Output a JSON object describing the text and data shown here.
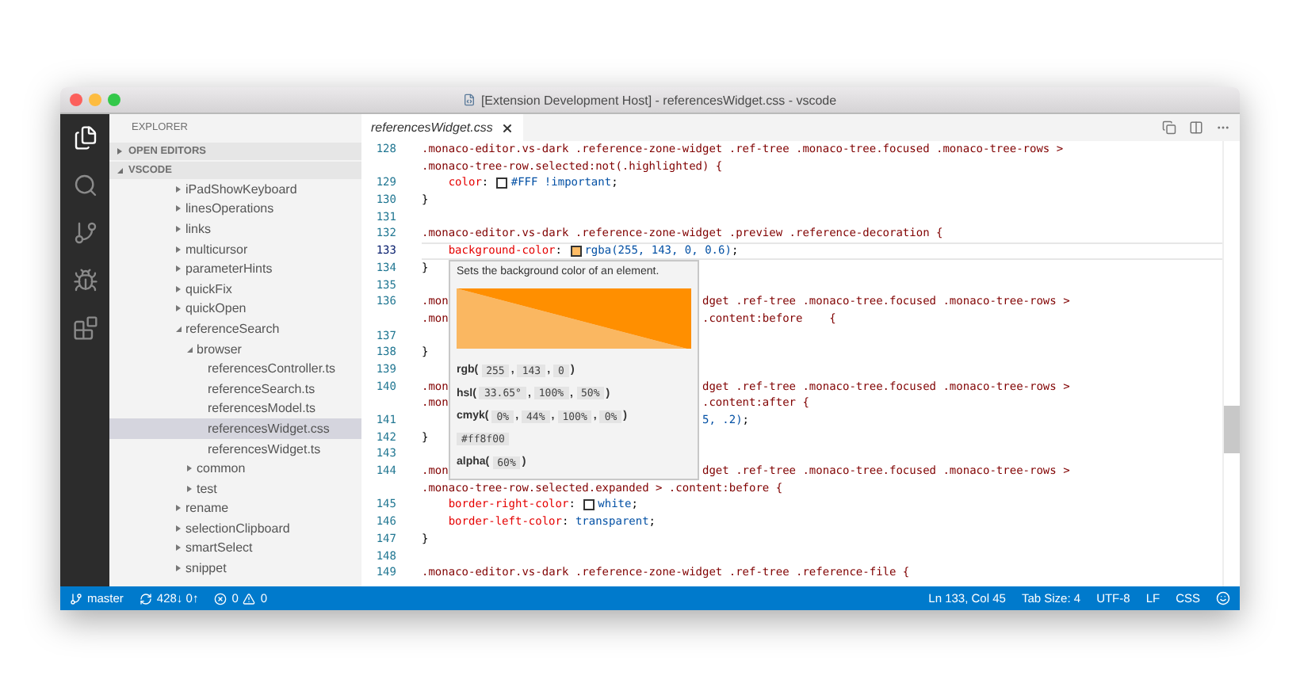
{
  "window": {
    "title": "[Extension Development Host] - referencesWidget.css - vscode"
  },
  "activity": [
    {
      "kind": "files",
      "selected": true
    },
    {
      "kind": "search",
      "selected": false
    },
    {
      "kind": "git",
      "selected": false
    },
    {
      "kind": "debug",
      "selected": false
    },
    {
      "kind": "extensions",
      "selected": false
    }
  ],
  "sidebar": {
    "title": "EXPLORER",
    "sections": [
      {
        "label": "OPEN EDITORS",
        "expanded": false
      },
      {
        "label": "VSCODE",
        "expanded": true,
        "items": [
          {
            "label": "iPadShowKeyboard",
            "expanded": false,
            "selected": false
          },
          {
            "label": "linesOperations",
            "expanded": false,
            "selected": false
          },
          {
            "label": "links",
            "expanded": false,
            "selected": false
          },
          {
            "label": "multicursor",
            "expanded": false,
            "selected": false
          },
          {
            "label": "parameterHints",
            "expanded": false,
            "selected": false
          },
          {
            "label": "quickFix",
            "expanded": false,
            "selected": false
          },
          {
            "label": "quickOpen",
            "expanded": false,
            "selected": false
          },
          {
            "label": "referenceSearch",
            "expanded": true,
            "selected": false,
            "children": [
              {
                "label": "browser",
                "expanded": true,
                "selected": false,
                "children": [
                  {
                    "label": "referencesController.ts",
                    "selected": false
                  },
                  {
                    "label": "referenceSearch.ts",
                    "selected": false
                  },
                  {
                    "label": "referencesModel.ts",
                    "selected": false
                  },
                  {
                    "label": "referencesWidget.css",
                    "selected": true
                  },
                  {
                    "label": "referencesWidget.ts",
                    "selected": false
                  }
                ]
              },
              {
                "label": "common",
                "expanded": false,
                "selected": false
              },
              {
                "label": "test",
                "expanded": false,
                "selected": false
              }
            ]
          },
          {
            "label": "rename",
            "expanded": false,
            "selected": false
          },
          {
            "label": "selectionClipboard",
            "expanded": false,
            "selected": false
          },
          {
            "label": "smartSelect",
            "expanded": false,
            "selected": false
          },
          {
            "label": "snippet",
            "expanded": false,
            "selected": false
          }
        ]
      }
    ]
  },
  "tabs": [
    {
      "label": "referencesWidget.css",
      "selected": true
    }
  ],
  "editor": {
    "lines": [
      {
        "num": "128",
        "current": false,
        "text": [
          {
            "kind": "sel",
            "text": ".monaco-editor.vs-dark .reference-zone-widget .ref-tree .monaco-tree.focused .monaco-tree-rows >"
          }
        ]
      },
      {
        "text": [
          {
            "kind": "sel",
            "text": ".monaco-tree-row.selected:not(.highlighted) {"
          }
        ]
      },
      {
        "num": "129",
        "current": false,
        "indented": true,
        "text": [
          {
            "kind": "prop",
            "text": "color"
          },
          {
            "kind": "plain",
            "text": ": "
          },
          {
            "kind": "swatch",
            "color": "#ffffff"
          },
          {
            "kind": "val",
            "text": "#FFF !important"
          },
          {
            "kind": "plain",
            "text": ";"
          }
        ]
      },
      {
        "num": "130",
        "current": false,
        "text": [
          {
            "kind": "plain",
            "text": "}"
          }
        ]
      },
      {
        "num": "131",
        "current": false
      },
      {
        "num": "132",
        "current": false,
        "text": [
          {
            "kind": "sel",
            "text": ".monaco-editor.vs-dark .reference-zone-widget .preview .reference-decoration {"
          }
        ]
      },
      {
        "num": "133",
        "current": true,
        "indented": true,
        "text": [
          {
            "kind": "prop",
            "text": "background-color"
          },
          {
            "kind": "plain",
            "text": ": "
          },
          {
            "kind": "swatch",
            "color": "#ffbc66"
          },
          {
            "kind": "val",
            "text": "rgba(255, 143, 0, 0.6)"
          },
          {
            "kind": "plain",
            "text": ";"
          }
        ]
      },
      {
        "num": "134",
        "current": false,
        "text": [
          {
            "kind": "plain",
            "text": "}"
          }
        ]
      },
      {
        "num": "135",
        "current": false
      },
      {
        "num": "136",
        "current": false,
        "text": [
          {
            "kind": "sel",
            "text": ".mon"
          }
        ],
        "tail": [
          {
            "kind": "sel",
            "text": "dget .ref-tree .monaco-tree.focused .monaco-tree-rows >"
          }
        ]
      },
      {
        "text": [
          {
            "kind": "sel",
            "text": ".mon"
          }
        ],
        "tail": [
          {
            "kind": "sel",
            "text": ".content:before    {"
          }
        ]
      },
      {
        "num": "137",
        "current": false
      },
      {
        "num": "138",
        "current": false,
        "text": [
          {
            "kind": "plain",
            "text": "}"
          }
        ]
      },
      {
        "num": "139",
        "current": false
      },
      {
        "num": "140",
        "current": false,
        "text": [
          {
            "kind": "sel",
            "text": ".mon"
          }
        ],
        "tail": [
          {
            "kind": "sel",
            "text": "dget .ref-tree .monaco-tree.focused .monaco-tree-rows >"
          }
        ]
      },
      {
        "text": [
          {
            "kind": "sel",
            "text": ".mon"
          }
        ],
        "tail": [
          {
            "kind": "sel",
            "text": ".content:after {"
          }
        ]
      },
      {
        "num": "141",
        "current": false,
        "tail": [
          {
            "kind": "val",
            "text": "5, .2)"
          },
          {
            "kind": "plain",
            "text": ";"
          }
        ]
      },
      {
        "num": "142",
        "current": false,
        "text": [
          {
            "kind": "plain",
            "text": "}"
          }
        ]
      },
      {
        "num": "143",
        "current": false
      },
      {
        "num": "144",
        "current": false,
        "text": [
          {
            "kind": "sel",
            "text": ".mon"
          }
        ],
        "tail": [
          {
            "kind": "sel",
            "text": "dget .ref-tree .monaco-tree.focused .monaco-tree-rows >"
          }
        ]
      },
      {
        "text": [
          {
            "kind": "sel",
            "text": ".monaco-tree-row.selected.expanded > .content:before {"
          }
        ]
      },
      {
        "num": "145",
        "current": false,
        "indented": true,
        "text": [
          {
            "kind": "prop",
            "text": "border-right-color"
          },
          {
            "kind": "plain",
            "text": ": "
          },
          {
            "kind": "swatch",
            "color": "#ffffff"
          },
          {
            "kind": "val",
            "text": "white"
          },
          {
            "kind": "plain",
            "text": ";"
          }
        ]
      },
      {
        "num": "146",
        "current": false,
        "indented": true,
        "text": [
          {
            "kind": "prop",
            "text": "border-left-color"
          },
          {
            "kind": "plain",
            "text": ": "
          },
          {
            "kind": "val",
            "text": "transparent"
          },
          {
            "kind": "plain",
            "text": ";"
          }
        ]
      },
      {
        "num": "147",
        "current": false,
        "text": [
          {
            "kind": "plain",
            "text": "}"
          }
        ]
      },
      {
        "num": "148",
        "current": false
      },
      {
        "num": "149",
        "current": false,
        "text": [
          {
            "kind": "sel",
            "text": ".monaco-editor.vs-dark .reference-zone-widget .ref-tree .reference-file {"
          }
        ]
      }
    ],
    "hover": {
      "description": "Sets the background color of an element.",
      "formats": [
        {
          "open": "rgb(",
          "sep": ",",
          "close": ")",
          "values": [
            "255",
            "143",
            "0"
          ]
        },
        {
          "open": "hsl(",
          "sep": ",",
          "close": ")",
          "values": [
            "33.65°",
            "100%",
            "50%"
          ]
        },
        {
          "open": "cmyk(",
          "sep": ",",
          "close": ")",
          "values": [
            "0%",
            "44%",
            "100%",
            "0%"
          ]
        },
        {
          "values": [
            "#ff8f00"
          ]
        },
        {
          "open": "alpha(",
          "close": ")",
          "values": [
            "60%"
          ]
        }
      ]
    }
  },
  "status_bar": {
    "branch": "master",
    "sync": "428↓ 0↑",
    "errors": "0",
    "warnings": "0",
    "items": [
      "Ln 133, Col 45",
      "Tab Size: 4",
      "UTF-8",
      "LF",
      "CSS"
    ]
  }
}
